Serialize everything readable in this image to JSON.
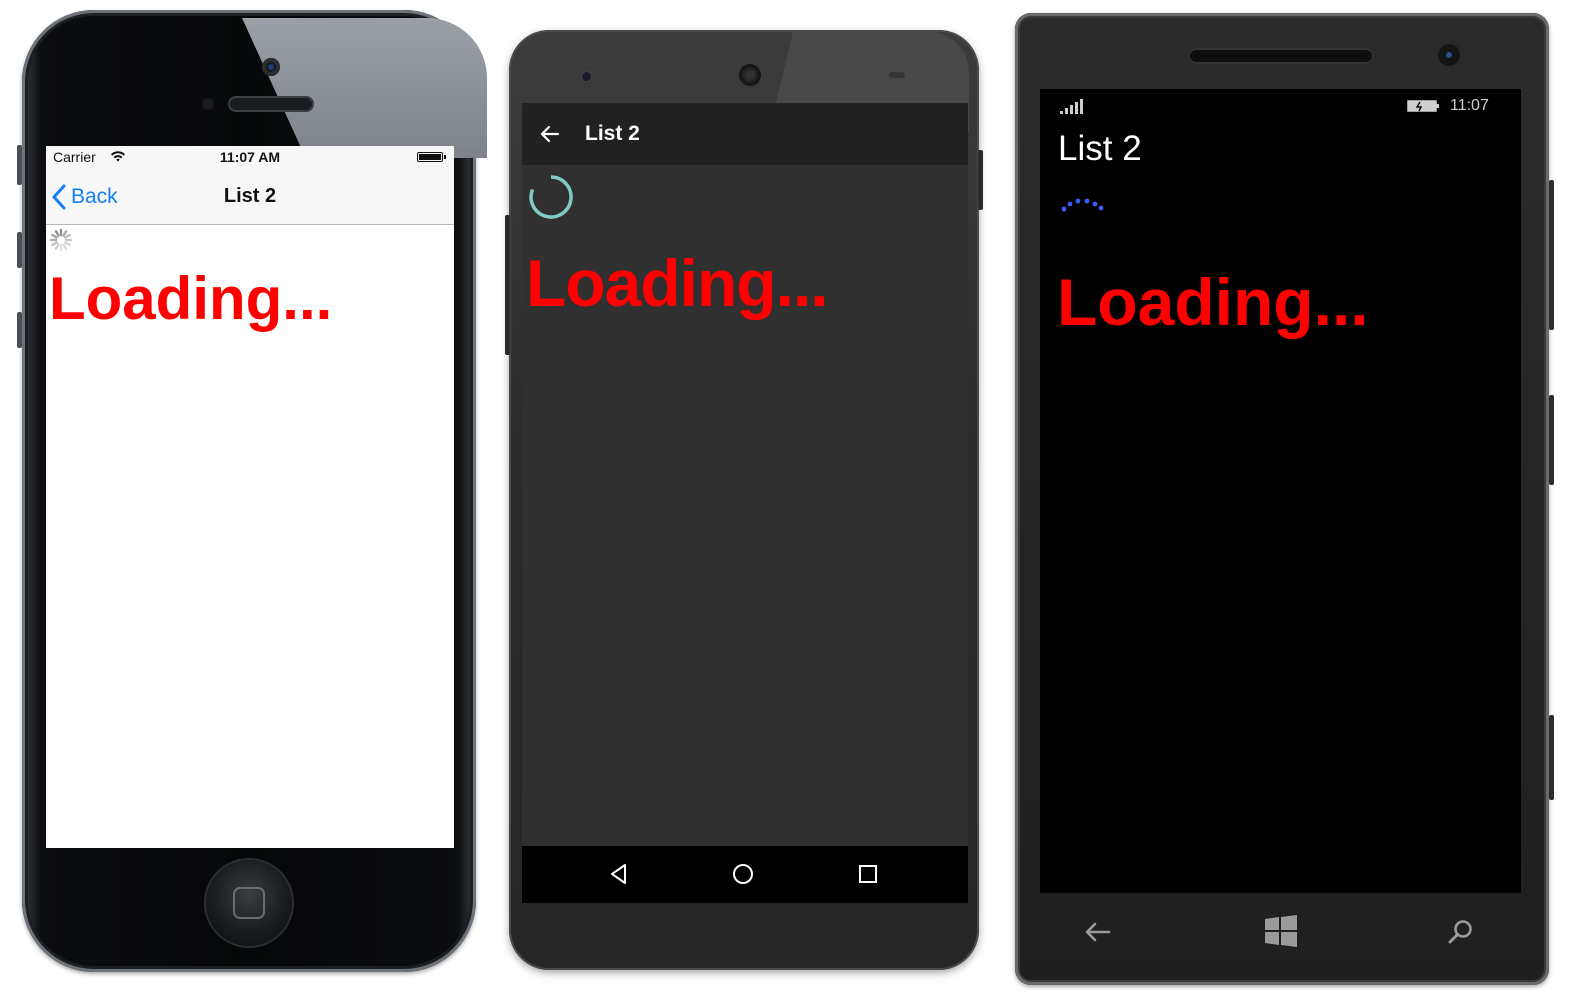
{
  "ios": {
    "carrier": "Carrier",
    "time": "11:07 AM",
    "back_label": "Back",
    "title": "List 2",
    "loading_text": "Loading...",
    "accent_color": "#157efb"
  },
  "android": {
    "title": "List 2",
    "loading_text": "Loading...",
    "spinner_color": "#80cbc4"
  },
  "windows_phone": {
    "time": "11:07",
    "title": "List 2",
    "loading_text": "Loading...",
    "progress_color": "#3d5afe"
  },
  "loading_color": "#ff0000",
  "icons": {
    "ios": [
      "wifi-icon",
      "battery-icon",
      "chevron-left-icon",
      "activity-spinner-icon",
      "home-button"
    ],
    "android": [
      "arrow-back-icon",
      "progress-ring-icon",
      "nav-back-icon",
      "nav-home-icon",
      "nav-recents-icon"
    ],
    "windows_phone": [
      "signal-strength-icon",
      "battery-icon",
      "progress-dots-icon",
      "back-arrow-icon",
      "windows-start-icon",
      "search-icon"
    ]
  }
}
